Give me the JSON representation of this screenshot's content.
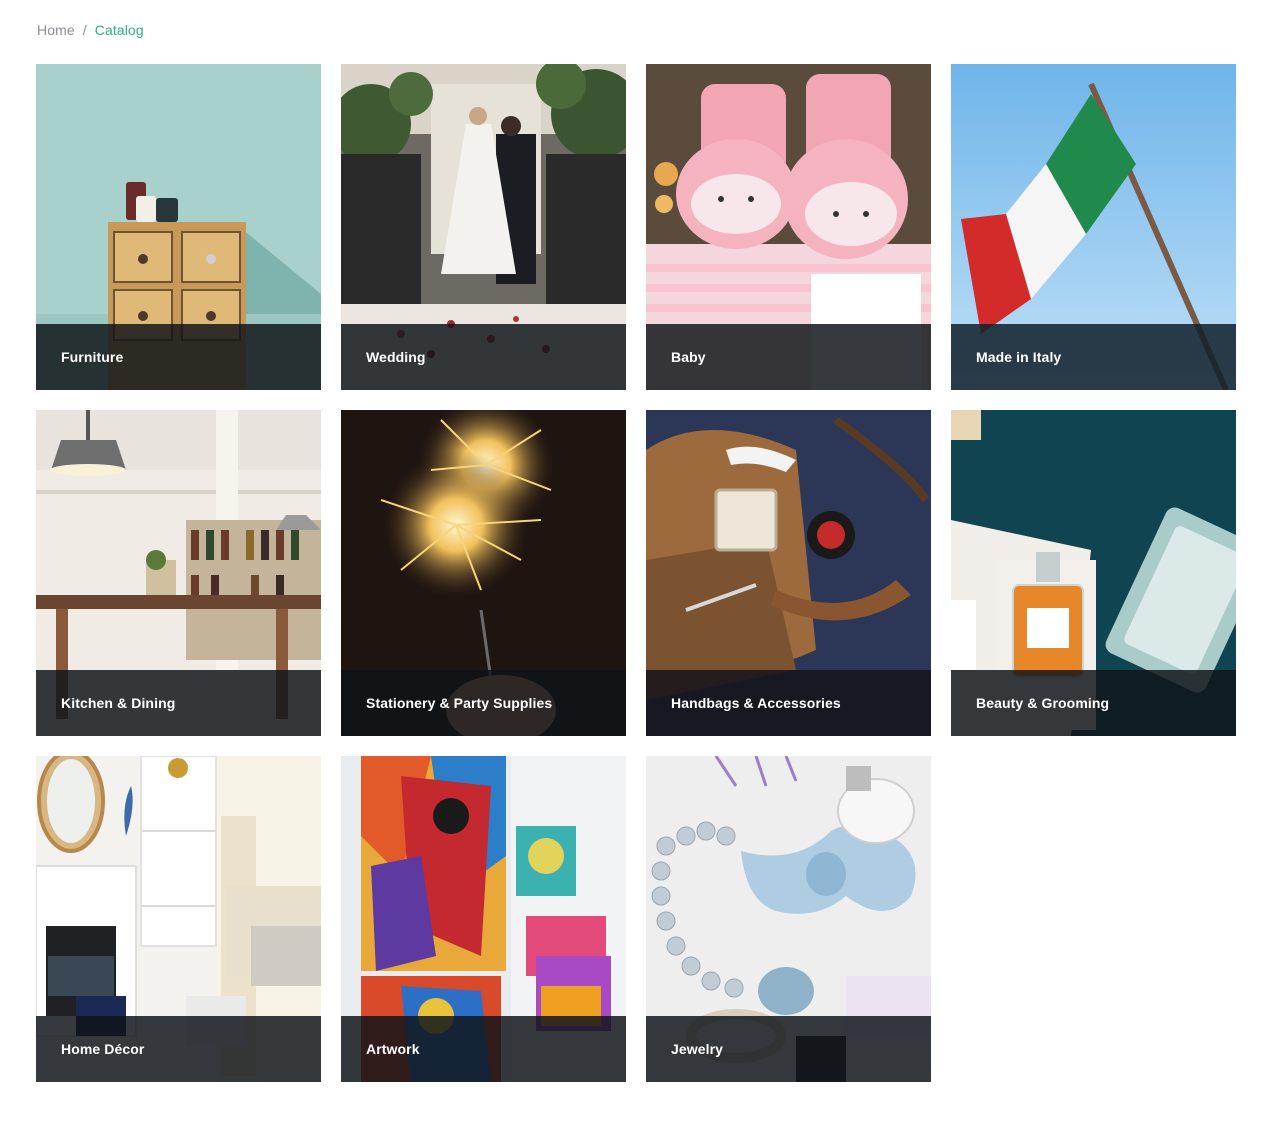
{
  "breadcrumb": {
    "home": "Home",
    "separator": "/",
    "current": "Catalog"
  },
  "colors": {
    "breadcrumb_muted": "#8a9096",
    "breadcrumb_active": "#2bb08a",
    "caption_overlay": "#0f1419",
    "caption_text": "#ffffff"
  },
  "categories": [
    {
      "label": "Furniture"
    },
    {
      "label": "Wedding"
    },
    {
      "label": "Baby"
    },
    {
      "label": "Made in Italy"
    },
    {
      "label": "Kitchen & Dining"
    },
    {
      "label": "Stationery & Party Supplies"
    },
    {
      "label": "Handbags & Accessories"
    },
    {
      "label": "Beauty & Grooming"
    },
    {
      "label": "Home Décor"
    },
    {
      "label": "Artwork"
    },
    {
      "label": "Jewelry"
    }
  ]
}
